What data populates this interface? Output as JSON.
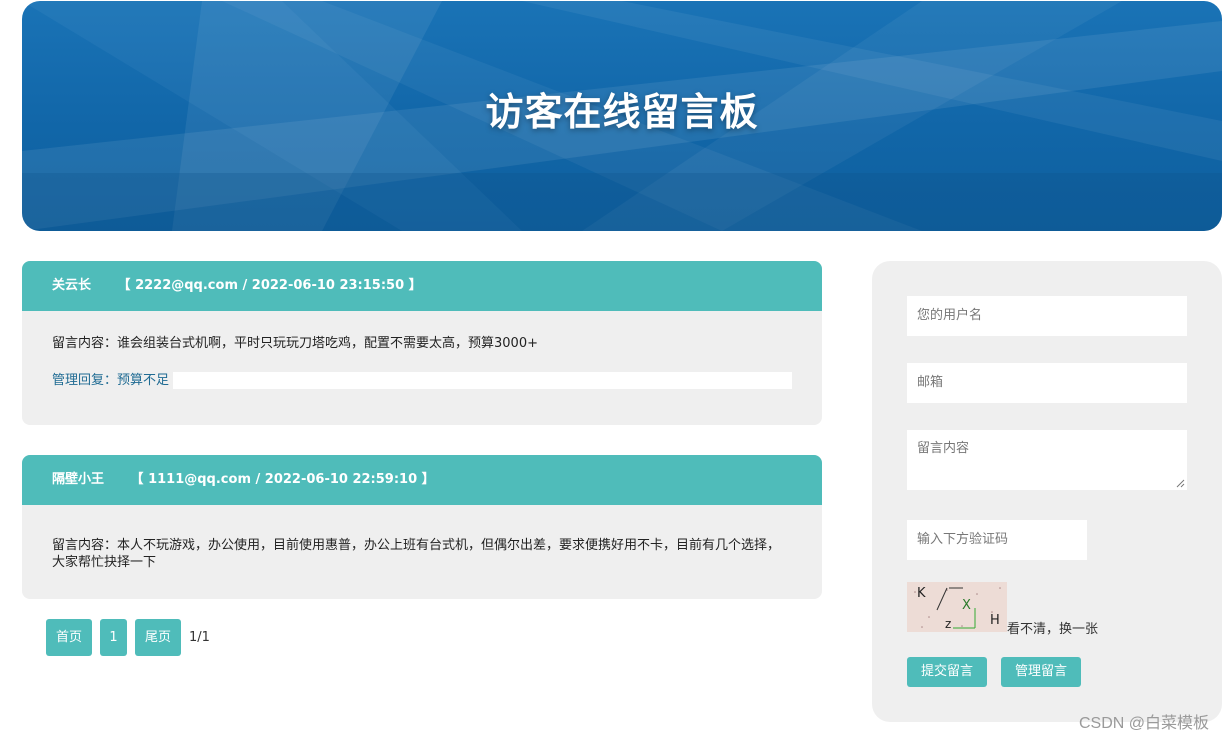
{
  "banner": {
    "title": "访客在线留言板"
  },
  "messages": [
    {
      "author": "关云长",
      "meta": "【 2222@qq.com / 2022-06-10 23:15:50 】",
      "content": "留言内容：谁会组装台式机啊，平时只玩玩刀塔吃鸡，配置不需要太高，预算3000+",
      "reply": "管理回复：预算不足"
    },
    {
      "author": "隔壁小王",
      "meta": "【 1111@qq.com / 2022-06-10 22:59:10 】",
      "content_line1": "留言内容：本人不玩游戏，办公使用，目前使用惠普，办公上班有台式机，但偶尔出差，要求便携好用不卡，目前有几个选择，",
      "content_line2": "大家帮忙抉择一下"
    }
  ],
  "pagination": {
    "first": "首页",
    "page": "1",
    "last": "尾页",
    "info": "1/1"
  },
  "form": {
    "username_placeholder": "您的用户名",
    "email_placeholder": "邮箱",
    "content_placeholder": "留言内容",
    "captcha_placeholder": "输入下方验证码",
    "captcha_chars": [
      "K",
      "X",
      "z",
      "H"
    ],
    "refresh_text": "看不清，换一张",
    "submit_label": "提交留言",
    "manage_label": "管理留言"
  },
  "watermark": "CSDN @白菜模板",
  "colors": {
    "accent": "#4fbcba",
    "banner": "#1166a8",
    "panel": "#efefef"
  }
}
